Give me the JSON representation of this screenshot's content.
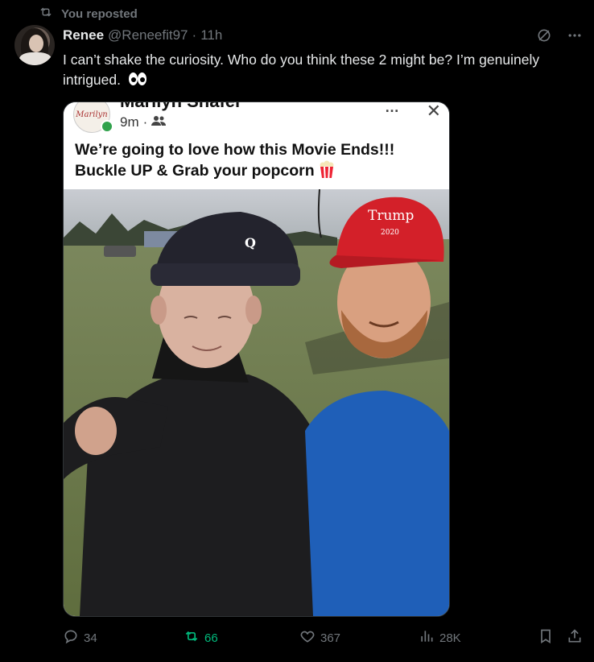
{
  "repost_banner": {
    "label": "You reposted"
  },
  "author": {
    "name": "Renee",
    "handle": "@Reneefit97",
    "separator": "·",
    "time": "11h"
  },
  "tweet": {
    "text": "I can’t shake the curiosity. Who do you think these 2 might be? I’m genuinely intrigued."
  },
  "embedded_post": {
    "author_name": "Marilyn Shafer",
    "avatar_text": "Marilyn",
    "time": "9m",
    "separator": "·",
    "more": "…",
    "close": "✕",
    "text": "We’re going to love how this Movie Ends!!! Buckle UP & Grab your popcorn",
    "hat_text_left": "Q",
    "hat_text_right": "Trump",
    "hat_year": "2020"
  },
  "actions": {
    "replies": "34",
    "reposts": "66",
    "likes": "367",
    "views": "28K"
  },
  "colors": {
    "background": "#000000",
    "text": "#e7e9ea",
    "muted": "#71767b",
    "repost_active": "#00ba7c"
  }
}
